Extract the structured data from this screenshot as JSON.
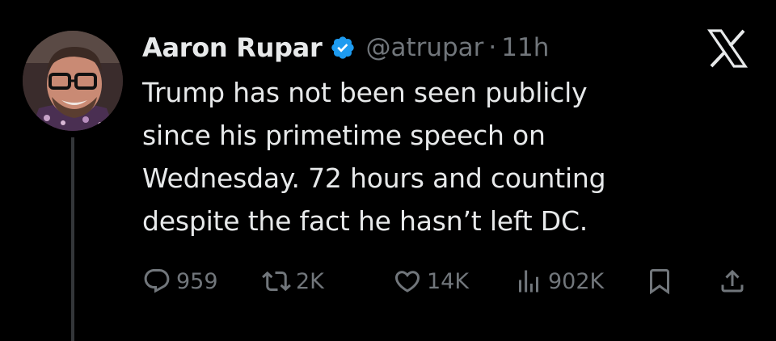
{
  "author": {
    "name": "Aaron Rupar",
    "handle": "@atrupar",
    "separator": "·",
    "time": "11h",
    "verified": true,
    "verified_color": "#1d9bf0"
  },
  "tweet": {
    "lines": [
      "Trump has not been seen publicly",
      "since his primetime speech on",
      "Wednesday. 72 hours and counting",
      "despite the fact he hasn’t left DC."
    ]
  },
  "metrics": {
    "replies": "959",
    "retweets": "2K",
    "likes": "14K",
    "views": "902K"
  },
  "icons": {
    "logo": "x-logo-icon",
    "verified": "verified-badge-icon",
    "reply": "reply-icon",
    "retweet": "retweet-icon",
    "like": "heart-icon",
    "views": "views-icon",
    "bookmark": "bookmark-icon",
    "share": "share-icon"
  },
  "colors": {
    "background": "#000000",
    "text": "#e7e9ea",
    "secondary": "#71767b",
    "thread_line": "#333639"
  }
}
